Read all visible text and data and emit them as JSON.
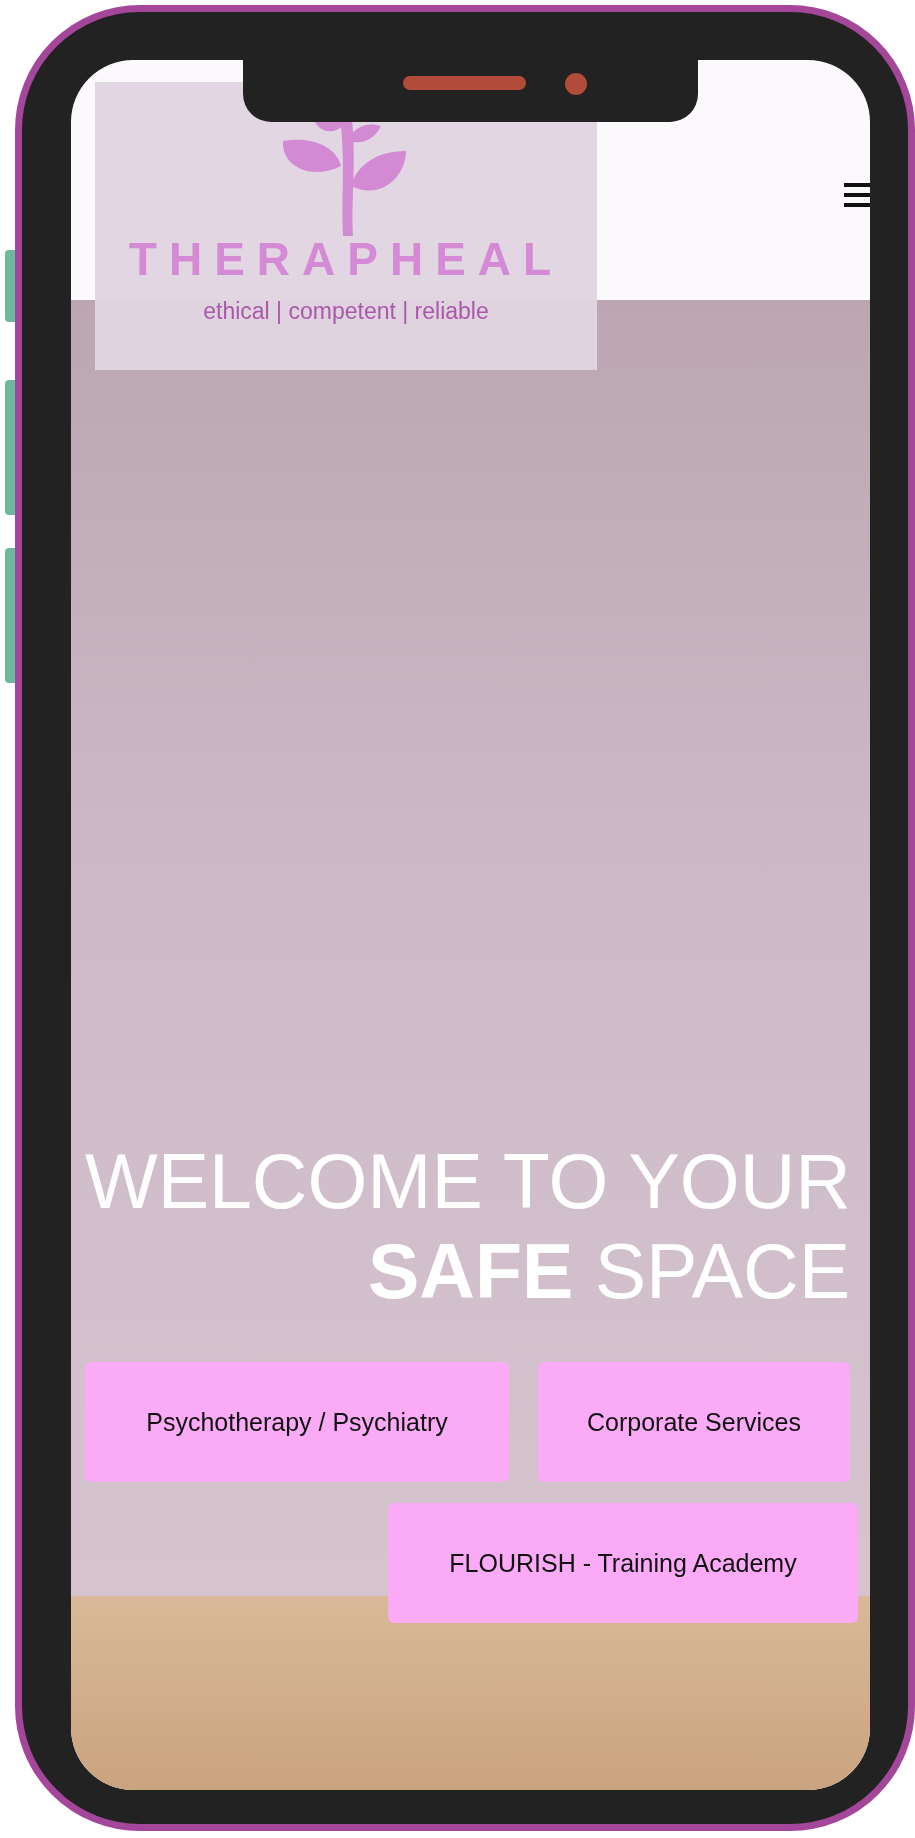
{
  "logo": {
    "name": "THERAPHEAL",
    "tagline": "ethical | competent | reliable"
  },
  "hero": {
    "heading_lines": [
      "WELCOME TO YOUR",
      "**SAFE** SPACE"
    ]
  },
  "service_buttons": [
    {
      "label": "Psychotherapy / Psychiatry"
    },
    {
      "label": "Corporate Services"
    },
    {
      "label": "FLOURISH - Training Academy"
    }
  ]
}
